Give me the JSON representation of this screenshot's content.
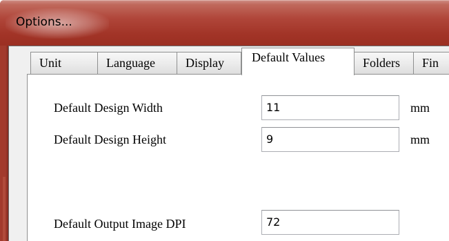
{
  "window": {
    "title": "Options..."
  },
  "tabs": [
    {
      "label": "Unit"
    },
    {
      "label": "Language"
    },
    {
      "label": "Display"
    },
    {
      "label": "Default Values",
      "active": true
    },
    {
      "label": "Folders"
    },
    {
      "label": "Fin"
    }
  ],
  "fields": [
    {
      "label": "Default Design Width",
      "value": "11",
      "unit": "mm"
    },
    {
      "label": "Default Design Height",
      "value": "9",
      "unit": "mm"
    },
    {
      "label": "Default Output Image DPI",
      "value": "72"
    }
  ]
}
